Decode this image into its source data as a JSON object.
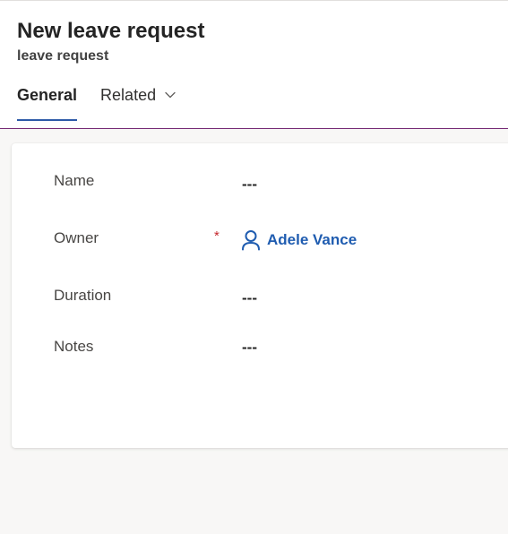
{
  "header": {
    "title": "New leave request",
    "subtitle": "leave request"
  },
  "tabs": [
    {
      "label": "General",
      "active": true
    },
    {
      "label": "Related",
      "active": false
    }
  ],
  "fields": {
    "name": {
      "label": "Name",
      "value": "---"
    },
    "owner": {
      "label": "Owner",
      "required_mark": "*",
      "value": "Adele Vance",
      "icon": "person-icon"
    },
    "duration": {
      "label": "Duration",
      "value": "---"
    },
    "notes": {
      "label": "Notes",
      "value": "---"
    }
  },
  "colors": {
    "accent": "#742774",
    "tab_underline": "#2d5aa8",
    "link": "#1f5cb0",
    "required": "#c5262c"
  }
}
